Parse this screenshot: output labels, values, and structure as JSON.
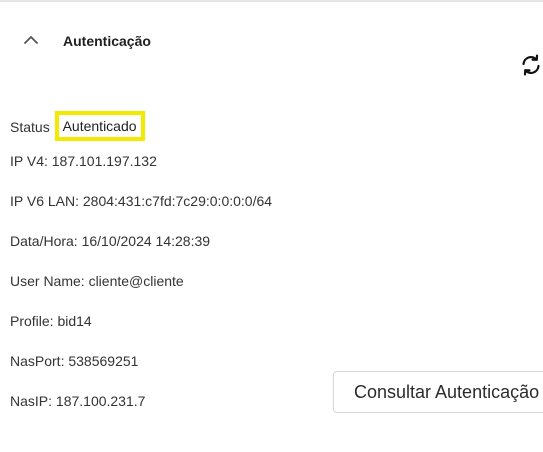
{
  "panel": {
    "title": "Autenticação",
    "toggle_icon": "chevron-up-icon",
    "refresh_icon": "refresh-icon"
  },
  "status": {
    "label": "Status",
    "value": "Autenticado",
    "highlight_color": "#f2ea00"
  },
  "fields": {
    "ipv4": "IP V4: 187.101.197.132",
    "ipv6": "IP V6 LAN: 2804:431:c7fd:7c29:0:0:0:0/64",
    "datetime": "Data/Hora: 16/10/2024 14:28:39",
    "username": "User Name: cliente@cliente",
    "profile": "Profile: bid14",
    "nasport": "NasPort: 538569251",
    "nasip": "NasIP: 187.100.231.7"
  },
  "actions": {
    "consult_label": "Consultar Autenticação"
  }
}
